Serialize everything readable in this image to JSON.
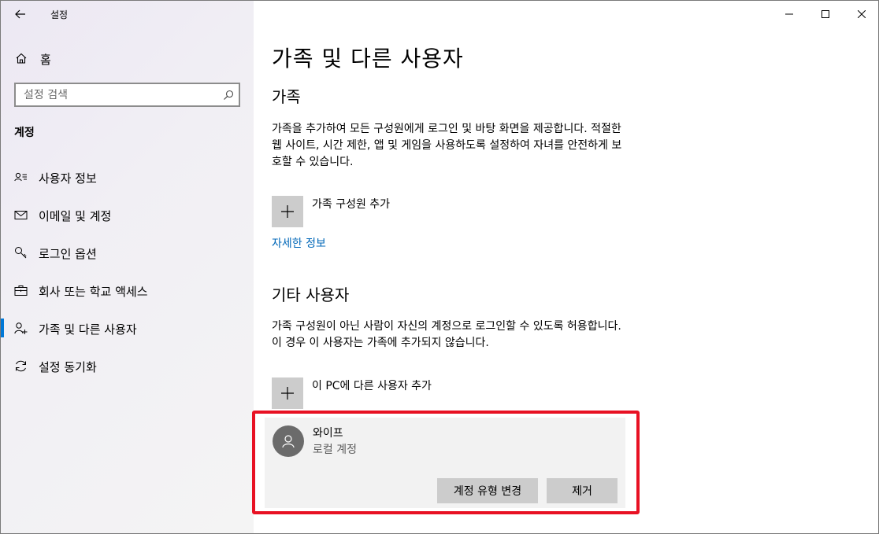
{
  "window": {
    "title": "설정"
  },
  "sidebar": {
    "home_label": "홈",
    "search_placeholder": "설정 검색",
    "section_title": "계정",
    "items": [
      {
        "label": "사용자 정보",
        "icon": "user-info-icon"
      },
      {
        "label": "이메일 및 계정",
        "icon": "mail-icon"
      },
      {
        "label": "로그인 옵션",
        "icon": "key-icon"
      },
      {
        "label": "회사 또는 학교 액세스",
        "icon": "briefcase-icon"
      },
      {
        "label": "가족 및 다른 사용자",
        "icon": "person-add-icon",
        "active": true
      },
      {
        "label": "설정 동기화",
        "icon": "sync-icon"
      }
    ]
  },
  "main": {
    "page_title": "가족 및 다른 사용자",
    "family": {
      "heading": "가족",
      "description": "가족을 추가하여 모든 구성원에게 로그인 및 바탕 화면을 제공합니다. 적절한 웹 사이트, 시간 제한, 앱 및 게임을 사용하도록 설정하여 자녀를 안전하게 보호할 수 있습니다.",
      "add_label": "가족 구성원 추가",
      "link_label": "자세한 정보"
    },
    "other_users": {
      "heading": "기타 사용자",
      "description": "가족 구성원이 아닌 사람이 자신의 계정으로 로그인할 수 있도록 허용합니다. 이 경우 이 사용자는 가족에 추가되지 않습니다.",
      "add_label": "이 PC에 다른 사용자 추가",
      "user": {
        "name": "와이프",
        "account_type": "로컬 계정",
        "change_type_label": "계정 유형 변경",
        "remove_label": "제거"
      }
    }
  },
  "colors": {
    "accent": "#0078d7",
    "link": "#0067b8",
    "highlight": "#e81123"
  }
}
